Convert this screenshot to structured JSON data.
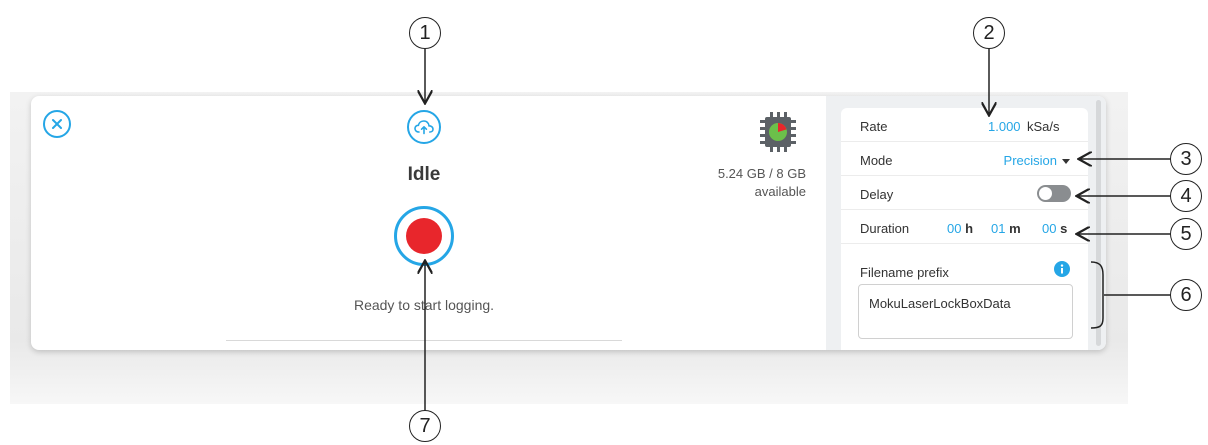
{
  "status": {
    "title": "Idle",
    "message": "Ready to start logging."
  },
  "storage": {
    "used_total": "5.24 GB / 8 GB",
    "available_label": "available",
    "icon": "memory-chip-icon"
  },
  "settings": {
    "rate": {
      "label": "Rate",
      "value": "1.000",
      "unit": "kSa/s"
    },
    "mode": {
      "label": "Mode",
      "value": "Precision"
    },
    "delay": {
      "label": "Delay",
      "enabled": false
    },
    "duration": {
      "label": "Duration",
      "hours": "00",
      "hours_unit": "h",
      "minutes": "01",
      "minutes_unit": "m",
      "seconds": "00",
      "seconds_unit": "s"
    },
    "filename_prefix": {
      "label": "Filename prefix",
      "value": "MokuLaserLockBoxData"
    }
  },
  "callouts": [
    "1",
    "2",
    "3",
    "4",
    "5",
    "6",
    "7"
  ],
  "colors": {
    "accent": "#25a6e6",
    "record": "#e8262c",
    "chip_green": "#6cc04a"
  }
}
